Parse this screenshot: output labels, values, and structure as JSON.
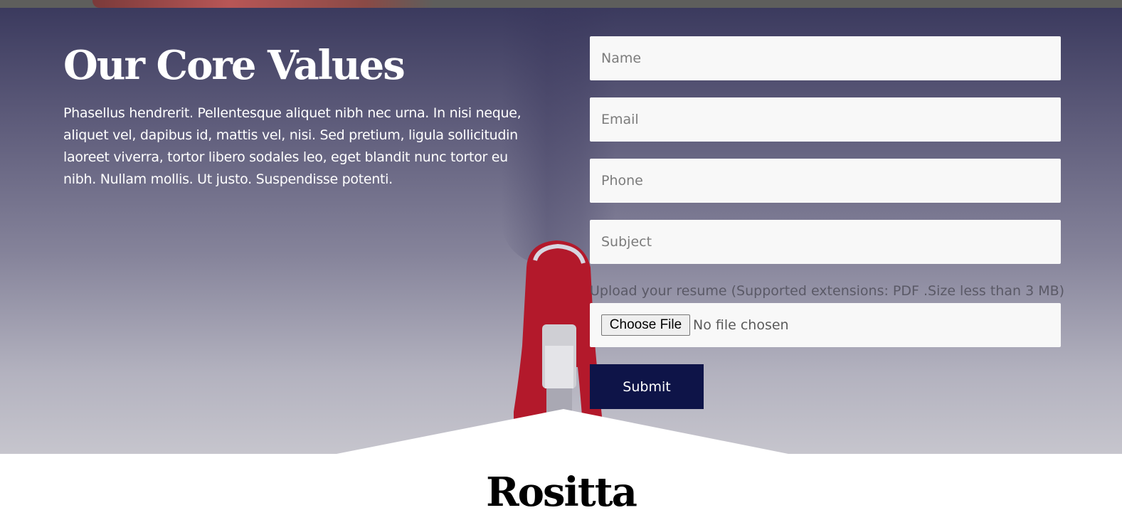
{
  "section": {
    "title": "Our Core Values",
    "description": "Phasellus hendrerit. Pellentesque aliquet nibh nec urna. In nisi neque, aliquet vel, dapibus id, mattis vel, nisi. Sed pretium, ligula sollicitudin laoreet viverra, tortor libero sodales leo, eget blandit nunc tortor eu nibh. Nullam mollis. Ut justo. Suspendisse potenti."
  },
  "form": {
    "name_placeholder": "Name",
    "email_placeholder": "Email",
    "phone_placeholder": "Phone",
    "subject_placeholder": "Subject",
    "upload_label": "Upload your resume (Supported extensions: PDF .Size less than 3 MB)",
    "choose_file_label": "Choose File",
    "no_file_text": "No file chosen",
    "submit_label": "Submit"
  },
  "footer": {
    "brand": "Rositta"
  },
  "colors": {
    "submit_bg": "#0e1448",
    "field_bg": "#f8f8f8",
    "hero_top": "#3b3a5e",
    "hero_bottom": "#c6c5cd"
  }
}
